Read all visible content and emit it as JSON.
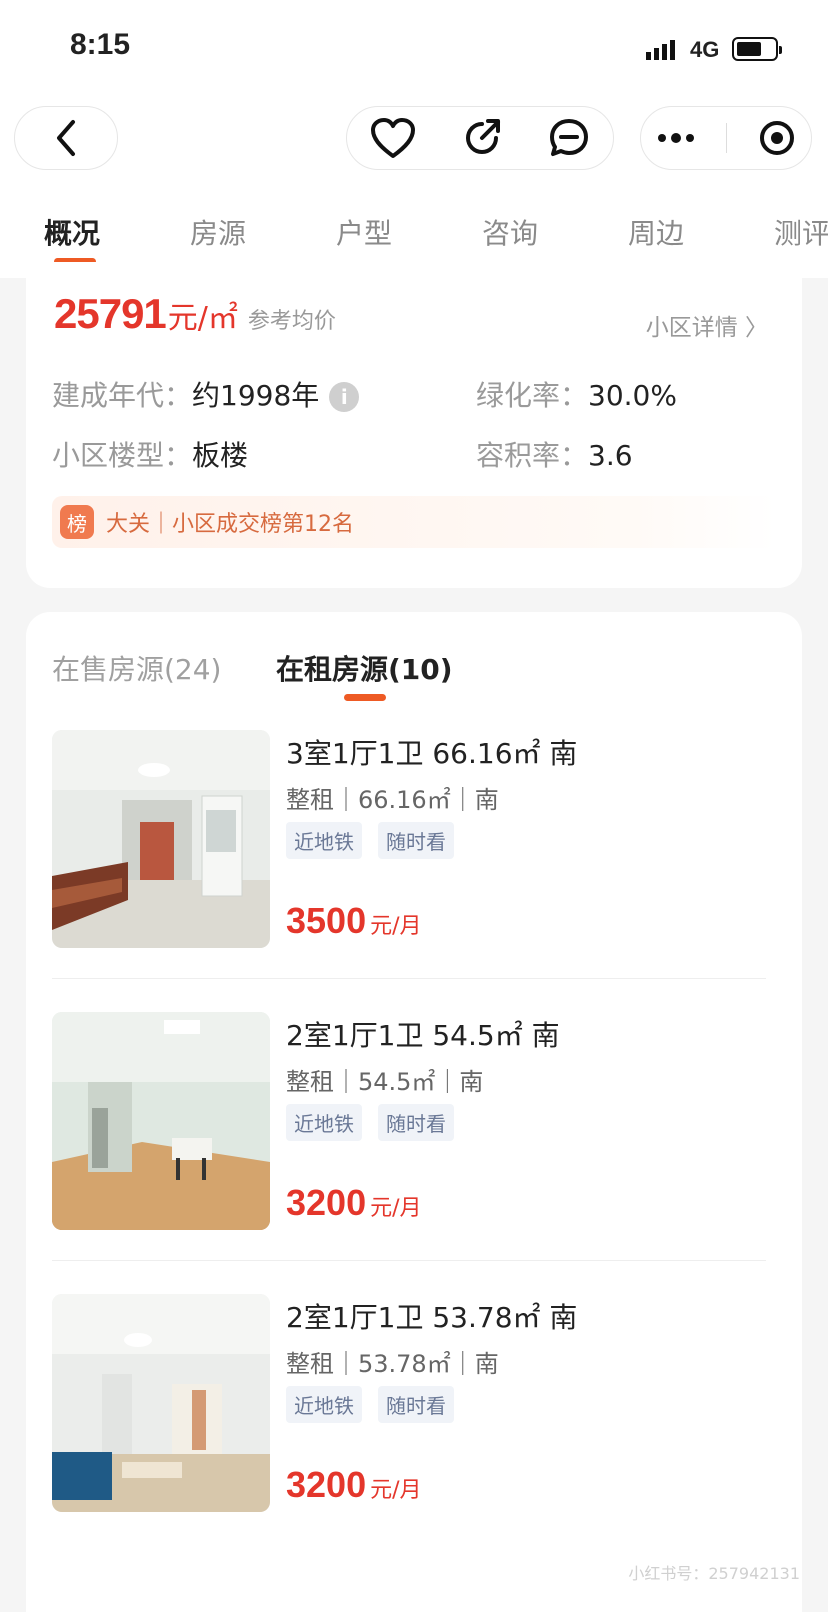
{
  "status": {
    "time": "8:15",
    "network": "4G"
  },
  "tabs": [
    "概况",
    "房源",
    "户型",
    "咨询",
    "周边",
    "测评"
  ],
  "community": {
    "price_value": "25791",
    "price_unit": "元/㎡",
    "price_ref": "参考均价",
    "detail_link": "小区详情 〉",
    "fields": [
      {
        "key": "建成年代：",
        "value": "约1998年"
      },
      {
        "key": "绿化率：",
        "value": "30.0%"
      },
      {
        "key": "小区楼型：",
        "value": "板楼"
      },
      {
        "key": "容积率：",
        "value": "3.6"
      }
    ],
    "rank_badge": "榜",
    "rank_text": "大关｜小区成交榜第12名"
  },
  "listings_tabs": {
    "sale": "在售房源(24)",
    "rent": "在租房源(10)"
  },
  "listings": [
    {
      "title": "3室1厅1卫 66.16㎡ 南",
      "sub": "整租｜66.16㎡｜南",
      "tags": [
        "近地铁",
        "随时看"
      ],
      "price": "3500",
      "unit": "元/月"
    },
    {
      "title": "2室1厅1卫 54.5㎡ 南",
      "sub": "整租｜54.5㎡｜南",
      "tags": [
        "近地铁",
        "随时看"
      ],
      "price": "3200",
      "unit": "元/月"
    },
    {
      "title": "2室1厅1卫 53.78㎡ 南",
      "sub": "整租｜53.78㎡｜南",
      "tags": [
        "近地铁",
        "随时看"
      ],
      "price": "3200",
      "unit": "元/月"
    }
  ],
  "watermark": "小红书号：257942131",
  "colors": {
    "accent": "#ee5a24",
    "price": "#e4362b"
  }
}
